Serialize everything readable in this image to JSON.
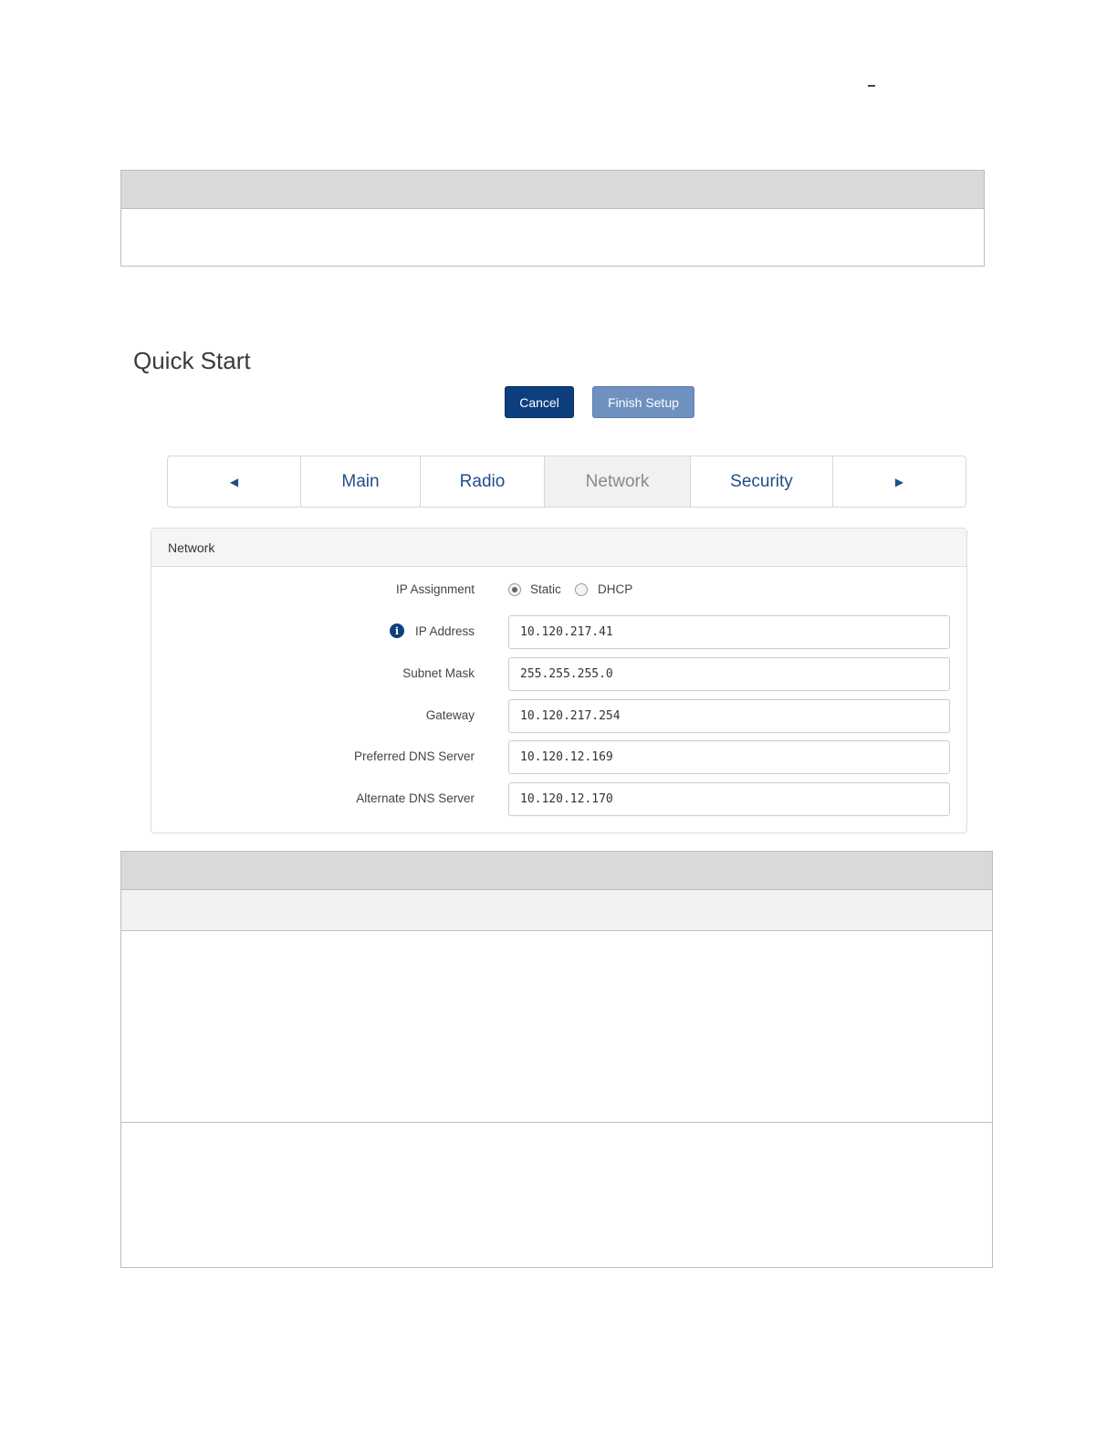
{
  "page": {
    "title": "Quick Start"
  },
  "buttons": {
    "cancel": "Cancel",
    "finish": "Finish Setup"
  },
  "tabs": {
    "prev_icon": "triangle-left-icon",
    "next_icon": "triangle-right-icon",
    "items": [
      {
        "label": "Main",
        "active": false
      },
      {
        "label": "Radio",
        "active": false
      },
      {
        "label": "Network",
        "active": true
      },
      {
        "label": "Security",
        "active": false
      }
    ]
  },
  "panel": {
    "title": "Network",
    "ip_assignment": {
      "label": "IP Assignment",
      "options": [
        "Static",
        "DHCP"
      ],
      "selected": "Static"
    },
    "fields": [
      {
        "label": "IP Address",
        "value": "10.120.217.41",
        "info_icon": "info-icon"
      },
      {
        "label": "Subnet Mask",
        "value": "255.255.255.0"
      },
      {
        "label": "Gateway",
        "value": "10.120.217.254"
      },
      {
        "label": "Preferred DNS Server",
        "value": "10.120.12.169"
      },
      {
        "label": "Alternate DNS Server",
        "value": "10.120.12.170"
      }
    ]
  }
}
